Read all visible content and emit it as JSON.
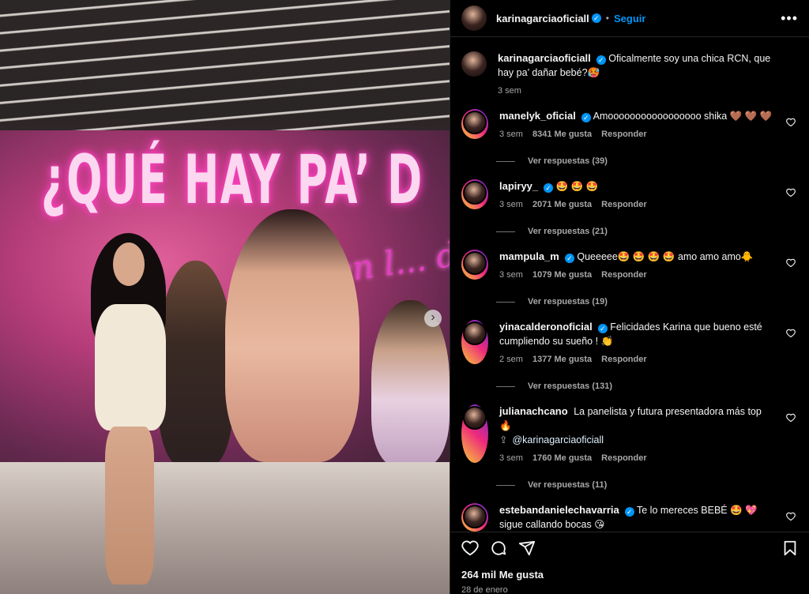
{
  "post": {
    "author": "karinagarciaoficiall",
    "follow_label": "Seguir",
    "more_label": "•••",
    "caption_text": "Oficalmente soy una chica RCN, que hay pa’ dañar bebé?🥵",
    "caption_time": "3 sem",
    "likes": "264 mil Me gusta",
    "date": "28 de enero"
  },
  "media": {
    "screen_title": "¿QUÉ HAY PA’ D",
    "screen_subtitle": "en l... de lo..."
  },
  "comments": [
    {
      "user": "manelyk_oficial",
      "text": "Amooooooooooooooooo shika 🤎 🤎 🤎",
      "time": "3 sem",
      "likes": "8341 Me gusta",
      "reply": "Responder",
      "replies": "Ver respuestas (39)"
    },
    {
      "user": "lapiryy_",
      "text": "🤩 🤩 🤩",
      "time": "3 sem",
      "likes": "2071 Me gusta",
      "reply": "Responder",
      "replies": "Ver respuestas (21)"
    },
    {
      "user": "mampula_m",
      "text": "Queeeee🤩 🤩 🤩 🤩  amo amo amo🐥",
      "time": "3 sem",
      "likes": "1079 Me gusta",
      "reply": "Responder",
      "replies": "Ver respuestas (19)"
    },
    {
      "user": "yinacalderonoficial",
      "text": "Felicidades Karina que bueno esté cumpliendo su sueño ! 👏",
      "time": "2 sem",
      "likes": "1377 Me gusta",
      "reply": "Responder",
      "replies": "Ver respuestas (131)"
    },
    {
      "user": "julianachcano",
      "text": "La panelista y futura presentadora más top 🔥",
      "mention": "@karinagarciaoficiall",
      "time": "3 sem",
      "likes": "1760 Me gusta",
      "reply": "Responder",
      "replies": "Ver respuestas (11)"
    },
    {
      "user": "estebandanielechavarria",
      "text": "Te lo mereces BEBÉ 🤩 💖  sigue callando bocas 😘"
    }
  ],
  "colors": {
    "accent": "#0095f6",
    "background": "#000000",
    "muted": "#a8a8a8"
  },
  "icons": [
    "heart-icon",
    "comment-icon",
    "share-icon",
    "bookmark-icon",
    "verified-icon",
    "chevron-right-icon"
  ]
}
